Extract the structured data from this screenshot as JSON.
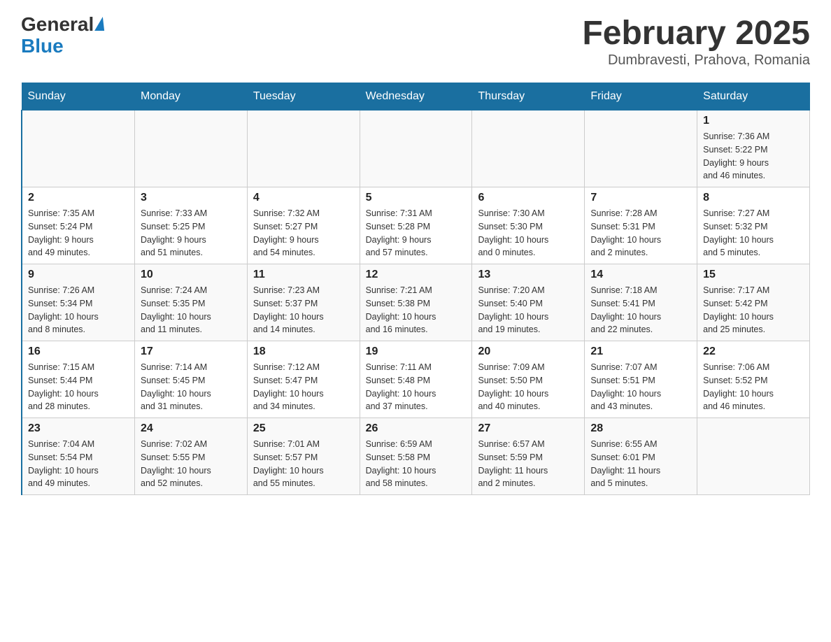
{
  "logo": {
    "general": "General",
    "triangle": "",
    "blue": "Blue"
  },
  "header": {
    "title": "February 2025",
    "location": "Dumbravesti, Prahova, Romania"
  },
  "days_of_week": [
    "Sunday",
    "Monday",
    "Tuesday",
    "Wednesday",
    "Thursday",
    "Friday",
    "Saturday"
  ],
  "weeks": [
    [
      {
        "day": "",
        "info": ""
      },
      {
        "day": "",
        "info": ""
      },
      {
        "day": "",
        "info": ""
      },
      {
        "day": "",
        "info": ""
      },
      {
        "day": "",
        "info": ""
      },
      {
        "day": "",
        "info": ""
      },
      {
        "day": "1",
        "info": "Sunrise: 7:36 AM\nSunset: 5:22 PM\nDaylight: 9 hours\nand 46 minutes."
      }
    ],
    [
      {
        "day": "2",
        "info": "Sunrise: 7:35 AM\nSunset: 5:24 PM\nDaylight: 9 hours\nand 49 minutes."
      },
      {
        "day": "3",
        "info": "Sunrise: 7:33 AM\nSunset: 5:25 PM\nDaylight: 9 hours\nand 51 minutes."
      },
      {
        "day": "4",
        "info": "Sunrise: 7:32 AM\nSunset: 5:27 PM\nDaylight: 9 hours\nand 54 minutes."
      },
      {
        "day": "5",
        "info": "Sunrise: 7:31 AM\nSunset: 5:28 PM\nDaylight: 9 hours\nand 57 minutes."
      },
      {
        "day": "6",
        "info": "Sunrise: 7:30 AM\nSunset: 5:30 PM\nDaylight: 10 hours\nand 0 minutes."
      },
      {
        "day": "7",
        "info": "Sunrise: 7:28 AM\nSunset: 5:31 PM\nDaylight: 10 hours\nand 2 minutes."
      },
      {
        "day": "8",
        "info": "Sunrise: 7:27 AM\nSunset: 5:32 PM\nDaylight: 10 hours\nand 5 minutes."
      }
    ],
    [
      {
        "day": "9",
        "info": "Sunrise: 7:26 AM\nSunset: 5:34 PM\nDaylight: 10 hours\nand 8 minutes."
      },
      {
        "day": "10",
        "info": "Sunrise: 7:24 AM\nSunset: 5:35 PM\nDaylight: 10 hours\nand 11 minutes."
      },
      {
        "day": "11",
        "info": "Sunrise: 7:23 AM\nSunset: 5:37 PM\nDaylight: 10 hours\nand 14 minutes."
      },
      {
        "day": "12",
        "info": "Sunrise: 7:21 AM\nSunset: 5:38 PM\nDaylight: 10 hours\nand 16 minutes."
      },
      {
        "day": "13",
        "info": "Sunrise: 7:20 AM\nSunset: 5:40 PM\nDaylight: 10 hours\nand 19 minutes."
      },
      {
        "day": "14",
        "info": "Sunrise: 7:18 AM\nSunset: 5:41 PM\nDaylight: 10 hours\nand 22 minutes."
      },
      {
        "day": "15",
        "info": "Sunrise: 7:17 AM\nSunset: 5:42 PM\nDaylight: 10 hours\nand 25 minutes."
      }
    ],
    [
      {
        "day": "16",
        "info": "Sunrise: 7:15 AM\nSunset: 5:44 PM\nDaylight: 10 hours\nand 28 minutes."
      },
      {
        "day": "17",
        "info": "Sunrise: 7:14 AM\nSunset: 5:45 PM\nDaylight: 10 hours\nand 31 minutes."
      },
      {
        "day": "18",
        "info": "Sunrise: 7:12 AM\nSunset: 5:47 PM\nDaylight: 10 hours\nand 34 minutes."
      },
      {
        "day": "19",
        "info": "Sunrise: 7:11 AM\nSunset: 5:48 PM\nDaylight: 10 hours\nand 37 minutes."
      },
      {
        "day": "20",
        "info": "Sunrise: 7:09 AM\nSunset: 5:50 PM\nDaylight: 10 hours\nand 40 minutes."
      },
      {
        "day": "21",
        "info": "Sunrise: 7:07 AM\nSunset: 5:51 PM\nDaylight: 10 hours\nand 43 minutes."
      },
      {
        "day": "22",
        "info": "Sunrise: 7:06 AM\nSunset: 5:52 PM\nDaylight: 10 hours\nand 46 minutes."
      }
    ],
    [
      {
        "day": "23",
        "info": "Sunrise: 7:04 AM\nSunset: 5:54 PM\nDaylight: 10 hours\nand 49 minutes."
      },
      {
        "day": "24",
        "info": "Sunrise: 7:02 AM\nSunset: 5:55 PM\nDaylight: 10 hours\nand 52 minutes."
      },
      {
        "day": "25",
        "info": "Sunrise: 7:01 AM\nSunset: 5:57 PM\nDaylight: 10 hours\nand 55 minutes."
      },
      {
        "day": "26",
        "info": "Sunrise: 6:59 AM\nSunset: 5:58 PM\nDaylight: 10 hours\nand 58 minutes."
      },
      {
        "day": "27",
        "info": "Sunrise: 6:57 AM\nSunset: 5:59 PM\nDaylight: 11 hours\nand 2 minutes."
      },
      {
        "day": "28",
        "info": "Sunrise: 6:55 AM\nSunset: 6:01 PM\nDaylight: 11 hours\nand 5 minutes."
      },
      {
        "day": "",
        "info": ""
      }
    ]
  ]
}
